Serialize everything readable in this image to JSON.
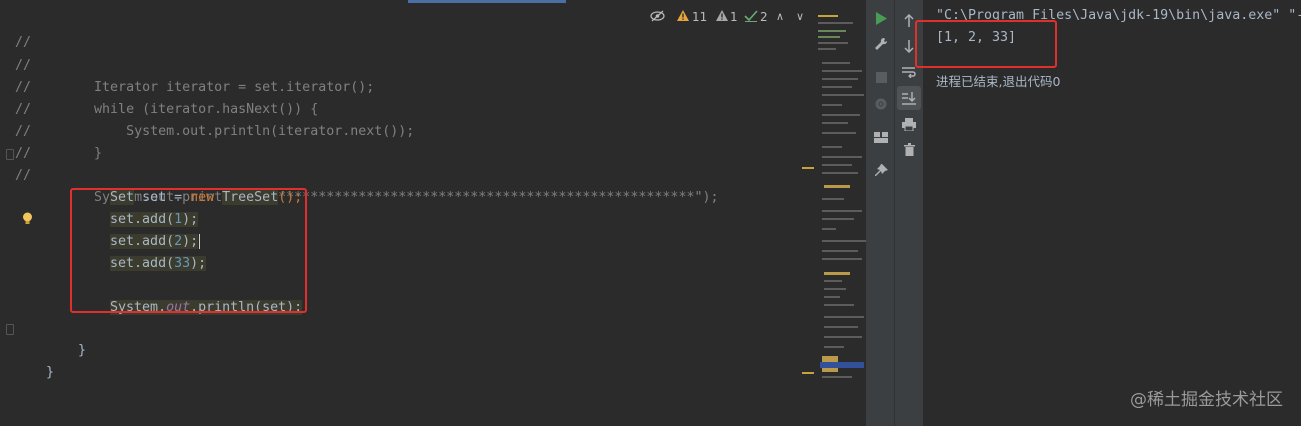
{
  "editor": {
    "inspections": {
      "warnings": "11",
      "weak_warnings": "1",
      "typos": "2",
      "up": "∧",
      "down": "∨"
    },
    "lines": [
      {
        "slash": "//",
        "text": ""
      },
      {
        "slash": "//",
        "text": "        Iterator iterator = set.iterator();"
      },
      {
        "slash": "//",
        "text": "        while (iterator.hasNext()) {"
      },
      {
        "slash": "//",
        "text": "            System.out.println(iterator.next());"
      },
      {
        "slash": "//",
        "text": "        }"
      },
      {
        "slash": "//",
        "text": ""
      },
      {
        "slash": "//",
        "text": "        System.out.println(\"*******************************************************\");"
      }
    ],
    "code": {
      "set_decl_type": "Set",
      "set_decl_mid": " set = ",
      "set_decl_new": "new",
      "set_decl_cls": "TreeSet",
      "set_decl_end": "();",
      "add1_pre": "set.add(",
      "add1_num": "1",
      "add1_post": ");",
      "add2_pre": "set.add(",
      "add2_num": "2",
      "add2_post": ");",
      "add3_pre": "set.add(",
      "add3_num": "33",
      "add3_post": ");",
      "print_pre": "System.",
      "print_field": "out",
      "print_post": ".println(set);",
      "close_method": "}",
      "close_class": "}"
    }
  },
  "console": {
    "command": "\"C:\\Program Files\\Java\\jdk-19\\bin\\java.exe\" \"-",
    "output": "[1, 2, 33]",
    "exit_message": "进程已结束,退出代码0"
  },
  "watermark": "@稀土掘金技术社区",
  "colors": {
    "annotation_red": "#e0302b",
    "run_green": "#499c54"
  }
}
